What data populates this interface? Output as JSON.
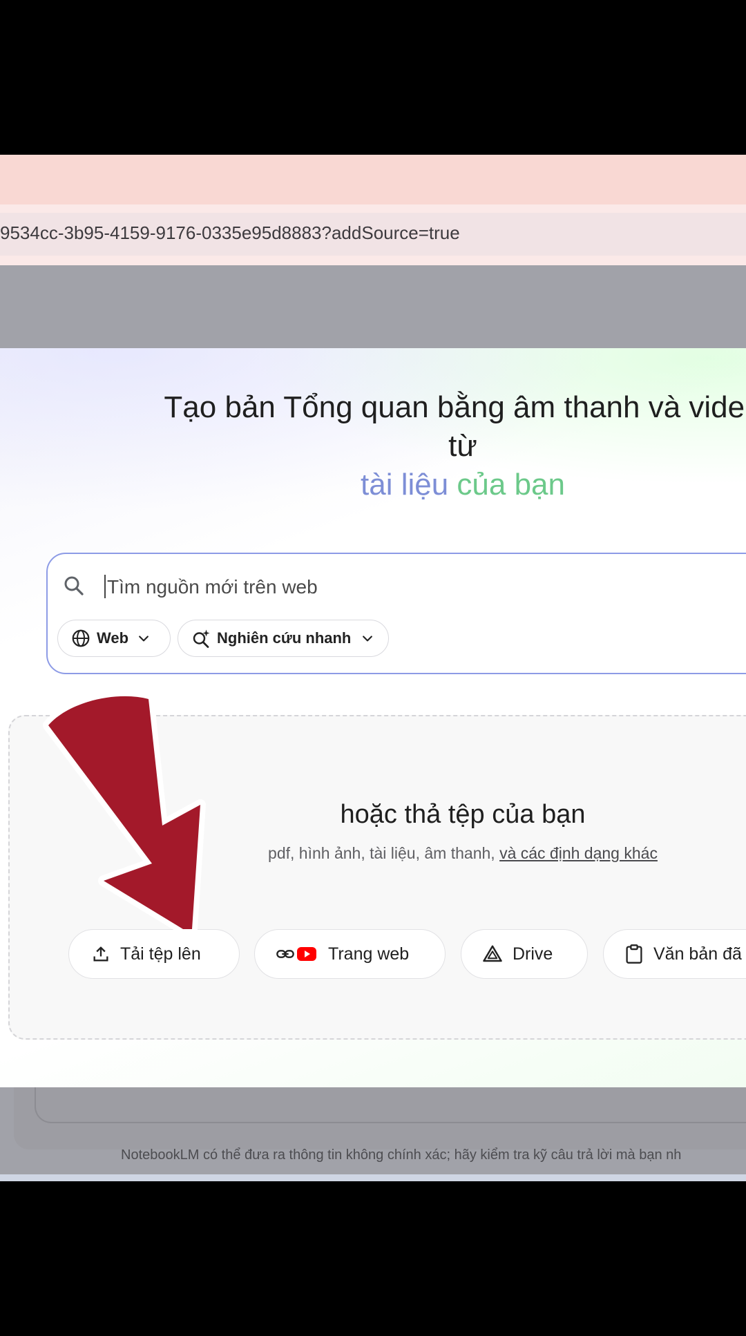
{
  "browser": {
    "url": "9534cc-3b95-4159-9176-0335e95d8883?addSource=true"
  },
  "dialog": {
    "headline_line1": "Tạo bản Tổng quan bằng âm thanh và video",
    "headline_line2": "từ",
    "headline_grad_part1": "tài liệu",
    "headline_grad_part2": "của bạn",
    "search": {
      "placeholder": "Tìm nguồn mới trên web",
      "value": "",
      "source_chip_label": "Web",
      "mode_chip_label": "Nghiên cứu nhanh",
      "icons": [
        "search-icon",
        "globe-icon",
        "chevron-down-icon",
        "sparkle-search-icon"
      ]
    },
    "drop_zone": {
      "title": "hoặc thả tệp của bạn",
      "subtitle": "pdf, hình ảnh, tài liệu, âm thanh,",
      "formats_link": "và các định dạng khác"
    },
    "source_buttons": [
      {
        "label": "Tải tệp lên",
        "icon": "upload-icon"
      },
      {
        "label": "Trang web",
        "icon": "link-youtube-icon"
      },
      {
        "label": "Drive",
        "icon": "drive-icon"
      },
      {
        "label": "Văn bản đã",
        "icon": "clipboard-icon"
      }
    ]
  },
  "footer": {
    "disclaimer": "NotebookLM có thể đưa ra thông tin không chính xác; hãy kiểm tra kỹ câu trả lời mà bạn nh"
  },
  "colors": {
    "search_border": "#8d9be6",
    "annotation_arrow": "#a3192a",
    "youtube_red": "#ff0000"
  }
}
